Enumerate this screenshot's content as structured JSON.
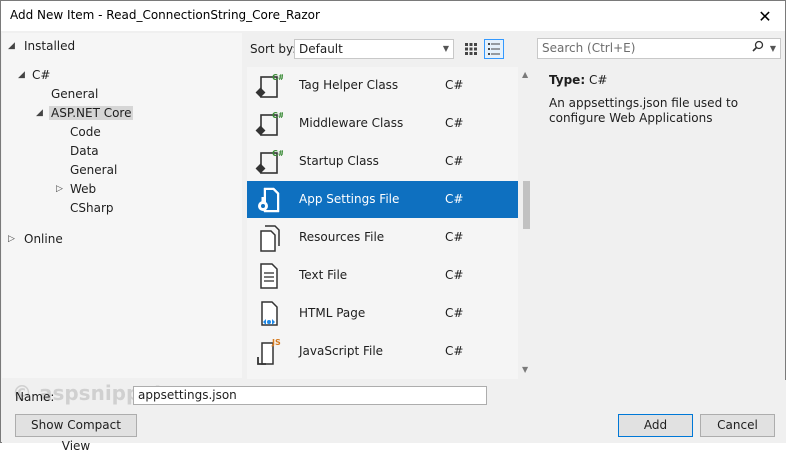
{
  "window": {
    "title": "Add New Item - Read_ConnectionString_Core_Razor",
    "close_glyph": "✕"
  },
  "tree": {
    "installed": "Installed",
    "csharp": "C#",
    "general": "General",
    "aspnet_core": "ASP.NET Core",
    "children": [
      "Code",
      "Data",
      "General",
      "Web",
      "CSharp"
    ],
    "online": "Online"
  },
  "toolbar": {
    "sort_label": "Sort by:",
    "sort_value": "Default",
    "search_placeholder": "Search (Ctrl+E)"
  },
  "items": [
    {
      "name": "Tag Helper Class",
      "lang": "C#",
      "icon": "class-csharp-icon"
    },
    {
      "name": "Middleware Class",
      "lang": "C#",
      "icon": "class-csharp-icon"
    },
    {
      "name": "Startup Class",
      "lang": "C#",
      "icon": "class-csharp-icon"
    },
    {
      "name": "App Settings File",
      "lang": "C#",
      "icon": "settings-file-icon",
      "selected": true
    },
    {
      "name": "Resources File",
      "lang": "C#",
      "icon": "resources-file-icon"
    },
    {
      "name": "Text File",
      "lang": "C#",
      "icon": "text-file-icon"
    },
    {
      "name": "HTML Page",
      "lang": "C#",
      "icon": "html-page-icon"
    },
    {
      "name": "JavaScript File",
      "lang": "C#",
      "icon": "javascript-file-icon"
    }
  ],
  "details": {
    "type_label": "Type:",
    "type_value": "C#",
    "description": "An appsettings.json file used to configure Web Applications"
  },
  "footer": {
    "name_label": "Name:",
    "name_value": "appsettings.json",
    "compact_view": "Show Compact View",
    "add": "Add",
    "cancel": "Cancel",
    "watermark": "© aspsnippets.com"
  },
  "colors": {
    "selection": "#0e70c0",
    "accent": "#0078d7"
  }
}
